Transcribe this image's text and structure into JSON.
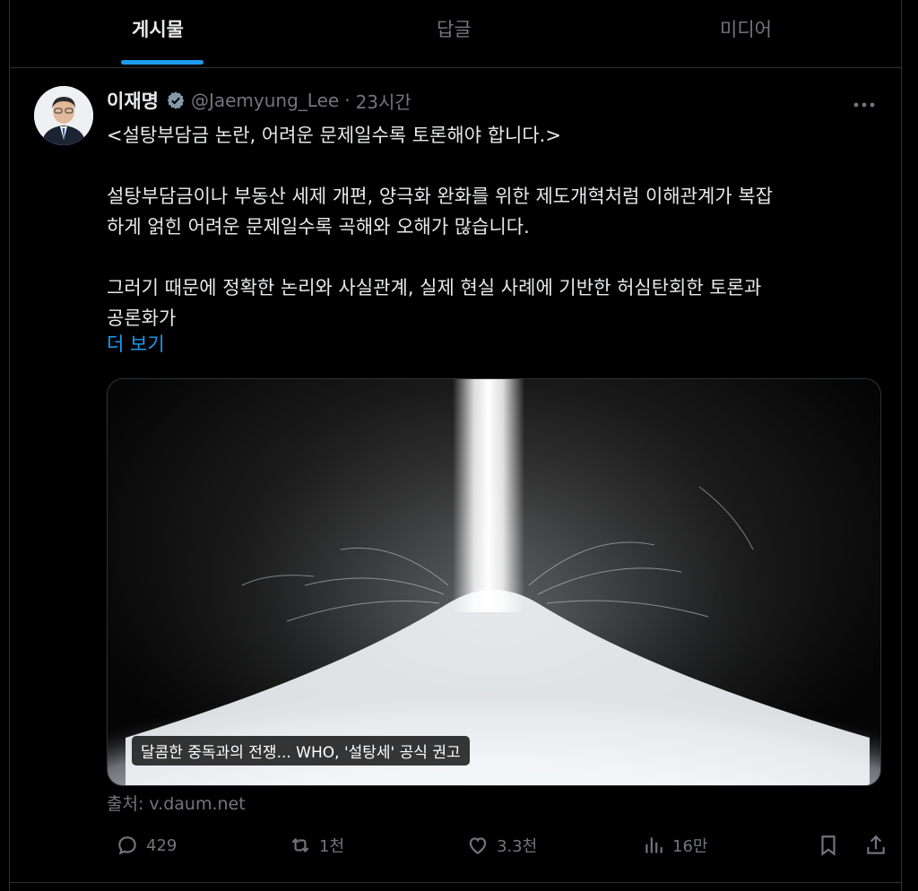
{
  "tabs": [
    {
      "label": "게시물",
      "active": true
    },
    {
      "label": "답글",
      "active": false
    },
    {
      "label": "미디어",
      "active": false
    }
  ],
  "post": {
    "display_name": "이재명",
    "handle": "@Jaemyung_Lee",
    "separator": "·",
    "time": "23시간",
    "more_icon": "more-horizontal-icon",
    "lines": [
      "<설탕부담금 논란, 어려운 문제일수록 토론해야 합니다.>",
      "",
      "설탕부담금이나 부동산 세제 개편, 양극화 완화를 위한 제도개혁처럼 이해관계가 복잡",
      "하게 얽힌 어려운 문제일수록 곡해와 오해가 많습니다.",
      "",
      "그러기 때문에 정확한 논리와 사실관계, 실제 현실 사례에 기반한 허심탄회한 토론과",
      "공론화가"
    ],
    "show_more": "더 보기",
    "media_caption": "달콤한 중독과의 전쟁... WHO, '설탕세' 공식 권고",
    "source": "출처: v.daum.net",
    "actions": {
      "reply": {
        "icon": "reply-icon",
        "count": "429"
      },
      "repost": {
        "icon": "repost-icon",
        "count": "1천"
      },
      "like": {
        "icon": "heart-icon",
        "count": "3.3천"
      },
      "views": {
        "icon": "views-chart-icon",
        "count": "16만"
      },
      "bookmark": {
        "icon": "bookmark-icon"
      },
      "share": {
        "icon": "share-icon"
      }
    }
  },
  "colors": {
    "background": "#000000",
    "text_primary": "#e7e9ea",
    "text_secondary": "#71767b",
    "accent": "#1d9bf0",
    "divider": "#2f3336"
  }
}
